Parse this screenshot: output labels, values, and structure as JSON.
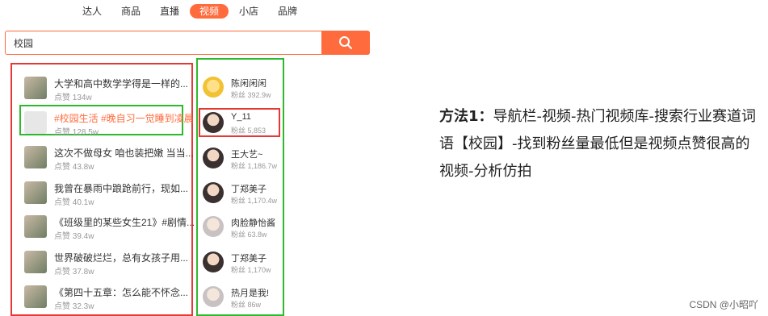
{
  "nav": {
    "tabs": [
      {
        "label": "达人"
      },
      {
        "label": "商品"
      },
      {
        "label": "直播"
      },
      {
        "label": "视频",
        "active": true
      },
      {
        "label": "小店"
      },
      {
        "label": "品牌"
      }
    ]
  },
  "search": {
    "value": "校园",
    "button_icon": "search-icon"
  },
  "videos": [
    {
      "title": "大学和高中数学学得是一样的...",
      "likes": "点赞 134w",
      "highlight": false
    },
    {
      "title": "#校园生活 #晚自习一觉睡到凌晨",
      "likes": "点赞 128.5w",
      "highlight": true
    },
    {
      "title": "这次不做母女 咱也装把嫩  当当...",
      "likes": "点赞 43.8w",
      "highlight": false
    },
    {
      "title": "我曾在暴雨中踉跄前行，现如...",
      "likes": "点赞 40.1w",
      "highlight": false
    },
    {
      "title": "《班级里的某些女生21》#剧情...",
      "likes": "点赞 39.4w",
      "highlight": false
    },
    {
      "title": "世界破破烂烂，总有女孩子用...",
      "likes": "点赞 37.8w",
      "highlight": false
    },
    {
      "title": "《第四十五章：怎么能不怀念...",
      "likes": "点赞 32.3w",
      "highlight": false
    }
  ],
  "users": [
    {
      "name": "陈闲闲闲",
      "fans": "粉丝 392.9w"
    },
    {
      "name": "Y_11",
      "fans": "粉丝 5,853"
    },
    {
      "name": "王大艺~",
      "fans": "粉丝 1,186.7w"
    },
    {
      "name": "丁郑美子",
      "fans": "粉丝 1,170.4w"
    },
    {
      "name": "肉脸静怡酱",
      "fans": "粉丝 63.8w"
    },
    {
      "name": "丁郑美子",
      "fans": "粉丝 1,170w"
    },
    {
      "name": "热月是我!",
      "fans": "粉丝 86w"
    }
  ],
  "annotation": {
    "label": "方法1：",
    "text": "导航栏-视频-热门视频库-搜索行业赛道词语【校园】-找到粉丝量最低但是视频点赞很高的视频-分析仿拍"
  },
  "watermark": "CSDN @小昭吖",
  "colors": {
    "accent": "#ff6b3d",
    "frame_red": "#e53935",
    "frame_green": "#2eb82e"
  }
}
